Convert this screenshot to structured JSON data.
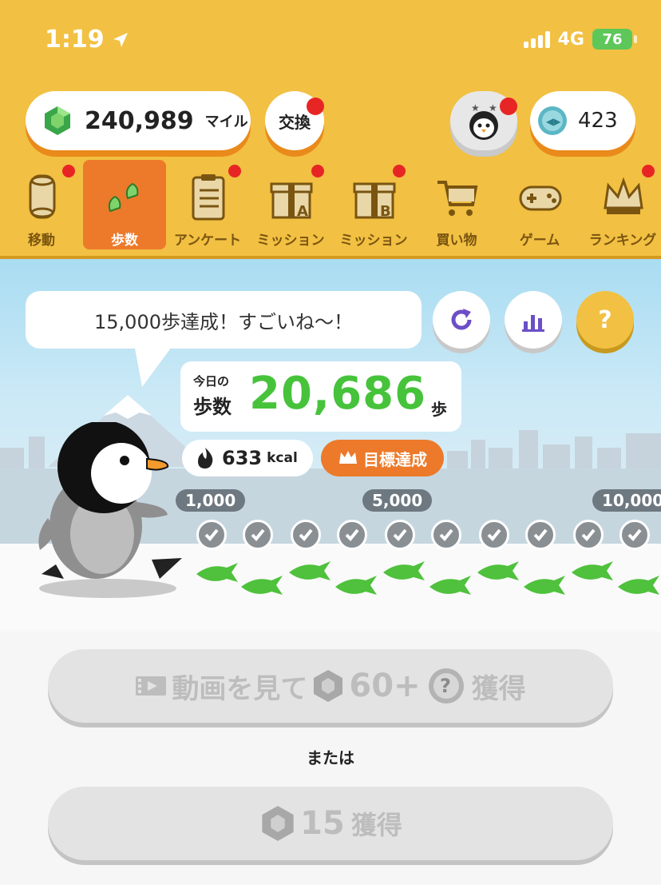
{
  "status_bar": {
    "time": "1:19",
    "network": "4G",
    "battery": "76"
  },
  "top": {
    "miles_value": "240,989",
    "miles_unit": "マイル",
    "exchange_label": "交換",
    "coins_value": "423"
  },
  "tabs": [
    {
      "label": "移動",
      "icon": "capsule-icon"
    },
    {
      "label": "歩数",
      "icon": "footprints-icon",
      "active": true
    },
    {
      "label": "アンケート",
      "icon": "clipboard-icon"
    },
    {
      "label": "ミッション",
      "icon": "gift-a-icon"
    },
    {
      "label": "ミッション",
      "icon": "gift-b-icon"
    },
    {
      "label": "買い物",
      "icon": "cart-icon"
    },
    {
      "label": "ゲーム",
      "icon": "gamepad-icon"
    },
    {
      "label": "ランキング",
      "icon": "crown-icon"
    }
  ],
  "speech": "15,000歩達成！すごいね〜！",
  "steps": {
    "label_top": "今日の",
    "label_bottom": "歩数",
    "value": "20,686",
    "unit": "歩"
  },
  "kcal": {
    "value": "633",
    "unit": "kcal"
  },
  "goal_badge": "目標達成",
  "milestones": [
    "1,000",
    "5,000",
    "10,000"
  ],
  "help_symbol": "?",
  "cta_video": {
    "prefix": "動画を見て",
    "amount": "60+",
    "suffix": "獲得"
  },
  "or_text": "または",
  "cta_get": {
    "amount": "15",
    "suffix": "獲得"
  },
  "colors": {
    "header": "#f2c042",
    "accent": "#ec7a2a",
    "green": "#46c33b"
  }
}
